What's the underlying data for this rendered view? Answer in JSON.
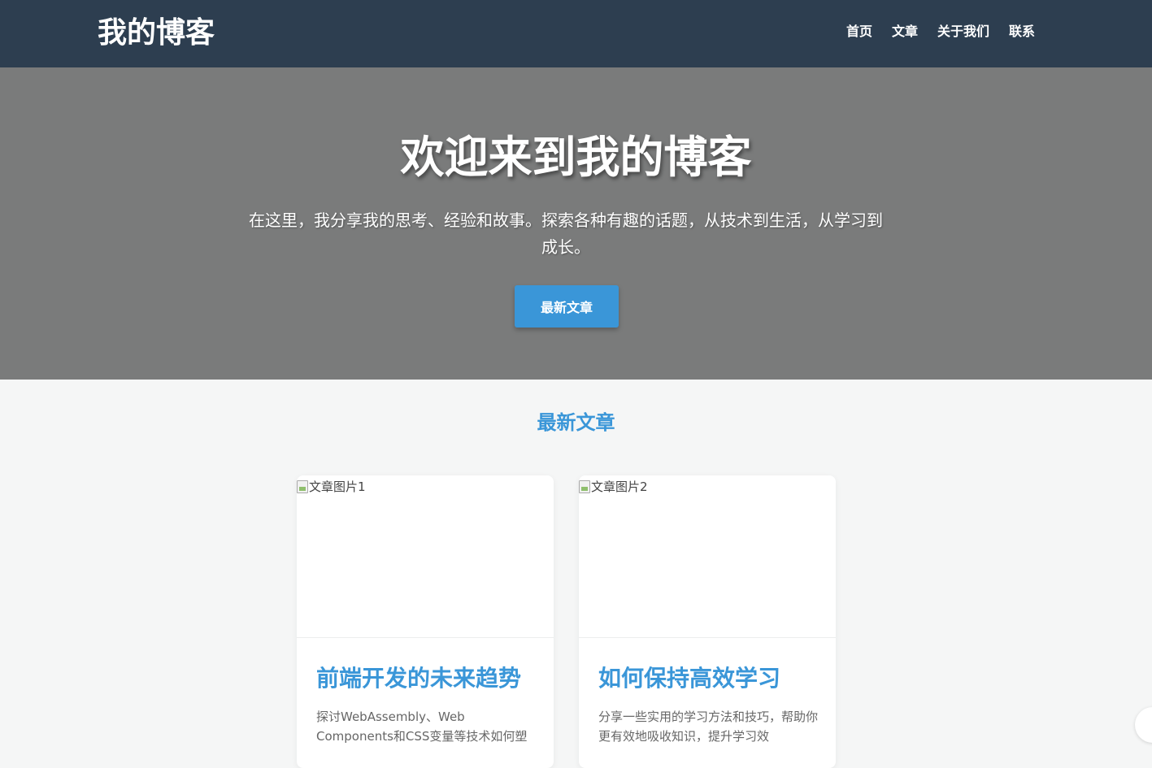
{
  "header": {
    "logo": "我的博客",
    "nav": [
      "首页",
      "文章",
      "关于我们",
      "联系"
    ]
  },
  "hero": {
    "title": "欢迎来到我的博客",
    "text": "在这里，我分享我的思考、经验和故事。探索各种有趣的话题，从技术到生活，从学习到成长。",
    "button": "最新文章"
  },
  "section": {
    "title": "最新文章"
  },
  "posts": [
    {
      "image_alt": "文章图片1",
      "title": "前端开发的未来趋势",
      "excerpt": "探讨WebAssembly、Web Components和CSS变量等技术如何塑"
    },
    {
      "image_alt": "文章图片2",
      "title": "如何保持高效学习",
      "excerpt": "分享一些实用的学习方法和技巧，帮助你更有效地吸收知识，提升学习效"
    }
  ],
  "colors": {
    "header_bg": "#2d3e50",
    "hero_bg": "#7a7b7b",
    "accent": "#3a96d8",
    "page_bg": "#f5f6f6"
  }
}
